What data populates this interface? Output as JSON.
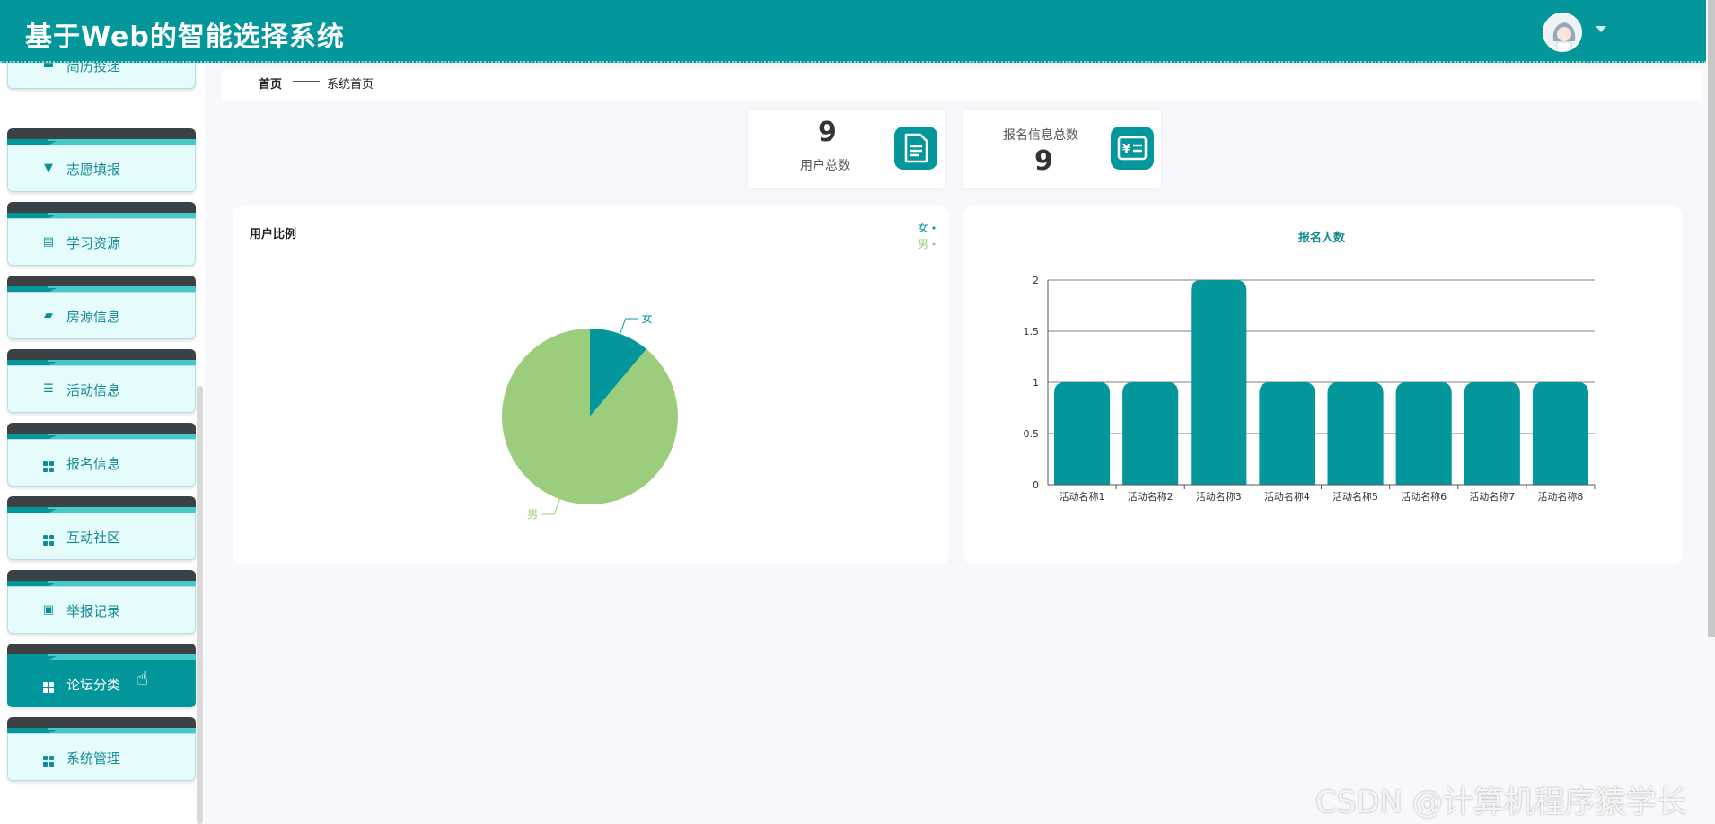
{
  "app": {
    "title": "基于Web的智能选择系统"
  },
  "sidebar": {
    "items": [
      {
        "label": "简历投递",
        "icon": "monitor-icon"
      },
      {
        "label": "志愿填报",
        "icon": "pin-icon"
      },
      {
        "label": "学习资源",
        "icon": "clipboard-icon"
      },
      {
        "label": "房源信息",
        "icon": "ticket-icon"
      },
      {
        "label": "活动信息",
        "icon": "list-icon"
      },
      {
        "label": "报名信息",
        "icon": "grid-icon"
      },
      {
        "label": "互动社区",
        "icon": "grid-icon"
      },
      {
        "label": "举报记录",
        "icon": "clipboard-x-icon"
      },
      {
        "label": "论坛分类",
        "icon": "grid-icon",
        "active": true
      },
      {
        "label": "系统管理",
        "icon": "grid-icon"
      }
    ]
  },
  "breadcrumb": {
    "home": "首页",
    "current": "系统首页"
  },
  "stats": [
    {
      "value": "9",
      "label": "用户总数",
      "icon": "document-icon"
    },
    {
      "value": "9",
      "label": "报名信息总数",
      "icon": "yen-card-icon"
    }
  ],
  "pie_panel": {
    "title": "用户比例",
    "legend": [
      "女",
      "男"
    ]
  },
  "bar_panel": {
    "title": "报名人数"
  },
  "chart_data": [
    {
      "type": "pie",
      "title": "用户比例",
      "labels": [
        "女",
        "男"
      ],
      "values": [
        1,
        8
      ],
      "colors": [
        "#03979c",
        "#9bcd7c"
      ],
      "legend_position": "top-right"
    },
    {
      "type": "bar",
      "title": "报名人数",
      "categories": [
        "活动名称1",
        "活动名称2",
        "活动名称3",
        "活动名称4",
        "活动名称5",
        "活动名称6",
        "活动名称7",
        "活动名称8"
      ],
      "values": [
        1,
        1,
        2,
        1,
        1,
        1,
        1,
        1
      ],
      "yticks": [
        "0",
        "0.5",
        "1",
        "1.5",
        "2"
      ],
      "ylim": [
        0,
        2
      ],
      "grid": true,
      "color": "#03979c"
    }
  ],
  "watermark": "CSDN @计算机程序猿学长"
}
